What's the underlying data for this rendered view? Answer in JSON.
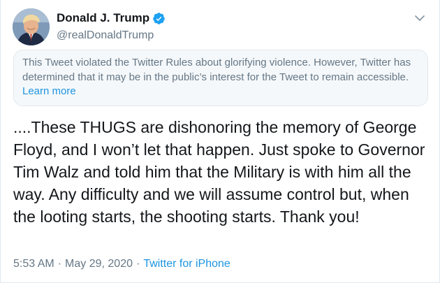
{
  "author": {
    "display_name": "Donald J. Trump",
    "handle": "@realDonaldTrump",
    "verified": true
  },
  "notice": {
    "text": "This Tweet violated the Twitter Rules about glorifying violence. However, Twitter has determined that it may be in the public’s interest for the Tweet to remain accessible. ",
    "link_label": "Learn more"
  },
  "tweet": {
    "text": "....These THUGS are dishonoring the memory of George Floyd, and I won’t let that happen. Just spoke to Governor Tim Walz and told him that the Military is with him all the way. Any difficulty and we will assume control but, when the looting starts, the shooting starts. Thank you!"
  },
  "meta": {
    "time": "5:53 AM",
    "separator": "·",
    "date": "May 29, 2020",
    "source": "Twitter for iPhone"
  },
  "colors": {
    "verified_blue": "#1da1f2",
    "link_blue": "#1b95e0",
    "secondary_text": "#657786",
    "notice_background": "#f5f8fa"
  },
  "icons": {
    "verified": "verified-badge-icon",
    "menu": "chevron-down-icon"
  }
}
